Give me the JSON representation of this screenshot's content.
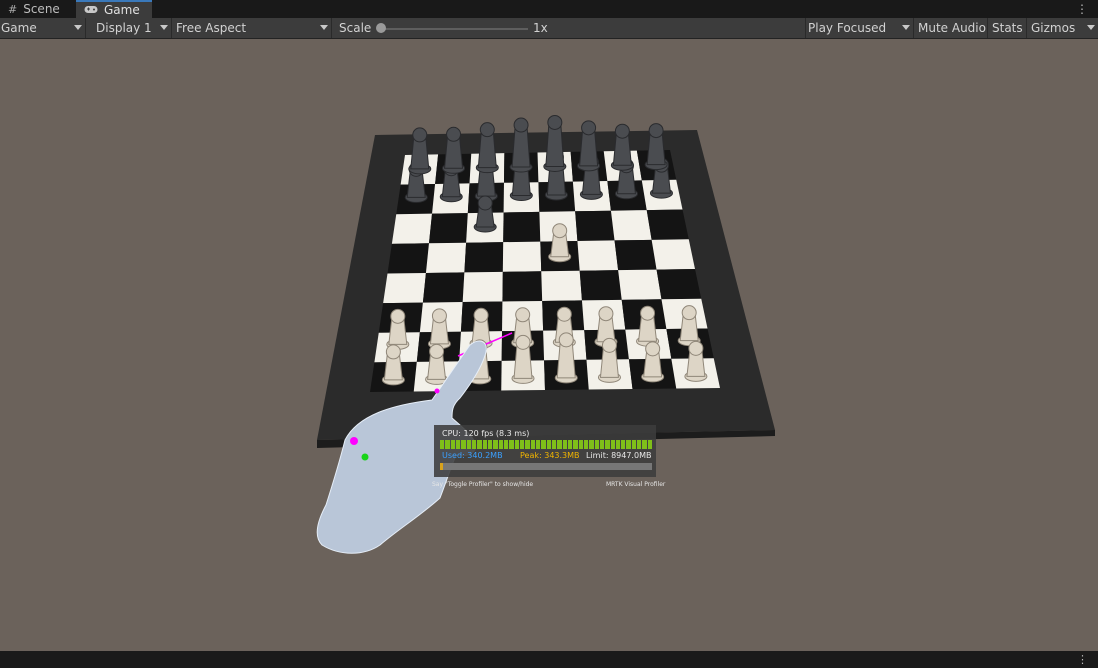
{
  "tabs": {
    "scene": "Scene",
    "game": "Game"
  },
  "toolbar": {
    "game_label": "Game",
    "display": "Display 1",
    "aspect": "Free Aspect",
    "scale_label": "Scale",
    "scale_value": "1x",
    "play_mode": "Play Focused",
    "mute": "Mute Audio",
    "stats": "Stats",
    "gizmos": "Gizmos"
  },
  "icons": {
    "scene": "hash-icon",
    "game": "gamepad-icon",
    "more": "kebab-icon"
  },
  "colors": {
    "accent": "#3a79bb",
    "viewport_bg": "#6b625b",
    "cpu_bar": "#7fbf19",
    "used": "#3aa0ff",
    "peak": "#f0b400"
  },
  "overlay": {
    "cpu": "CPU: 120 fps (8.3 ms)",
    "used": "Used: 340.2MB",
    "peak": "Peak: 343.3MB",
    "limit": "Limit: 8947.0MB",
    "hint_left": "Say \"Toggle Profiler\" to show/hide",
    "hint_right": "MRTK Visual Profiler"
  }
}
